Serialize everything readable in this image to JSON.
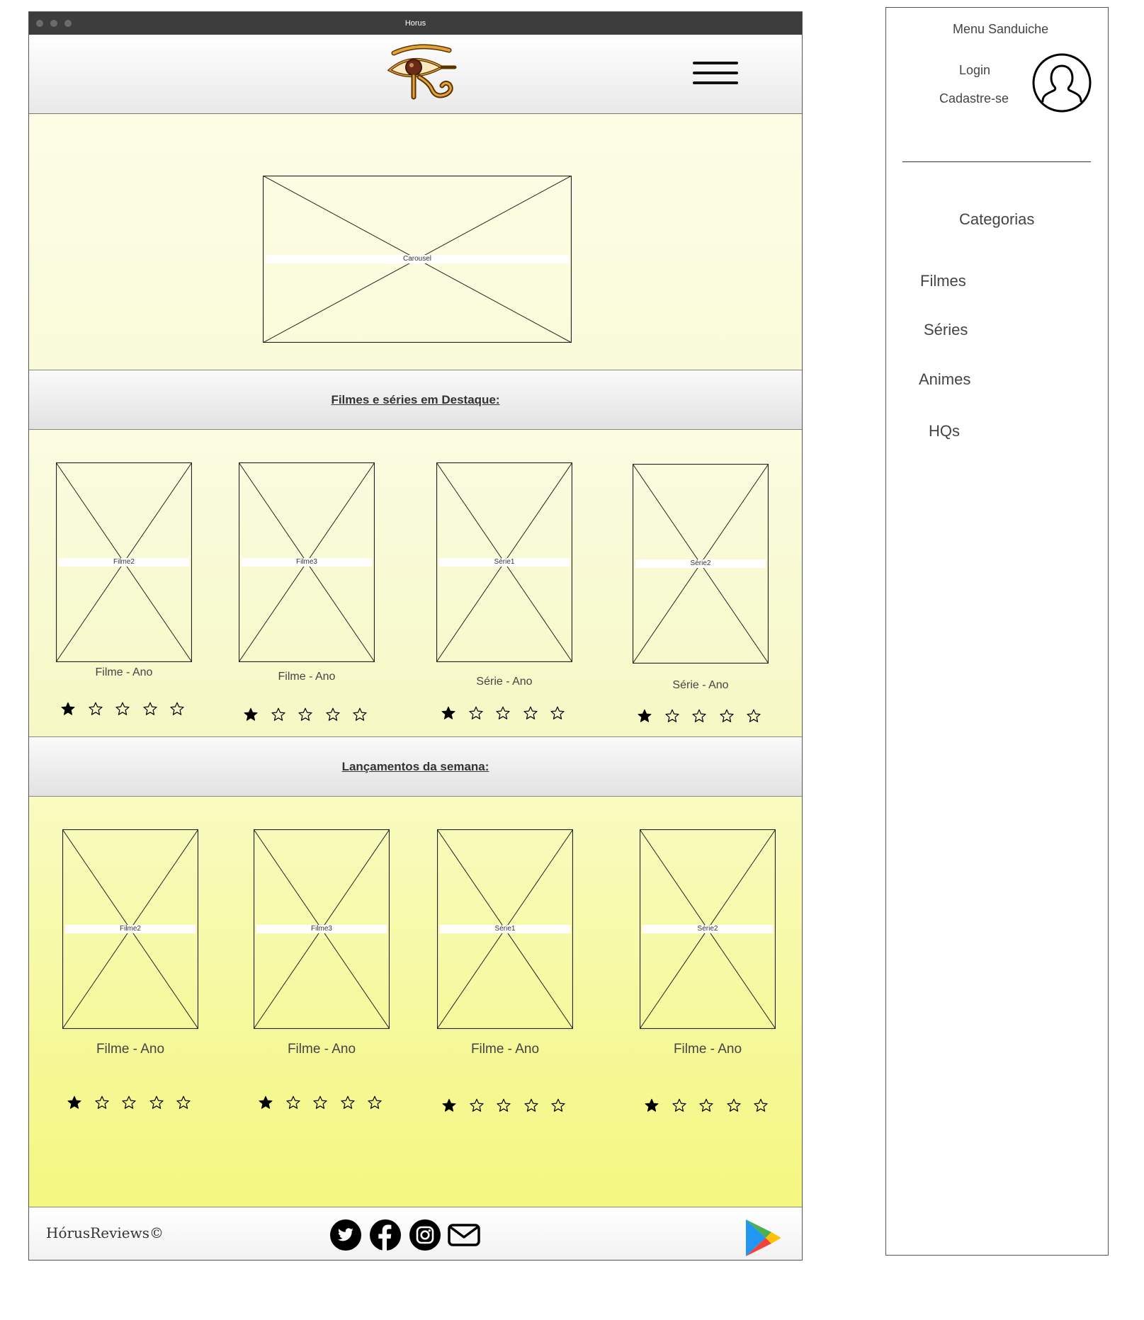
{
  "window": {
    "title": "Horus"
  },
  "header": {
    "logo_icon": "eye-of-horus-logo",
    "menu_icon": "hamburger-icon"
  },
  "hero": {
    "carousel_label": "Carousel"
  },
  "featured": {
    "heading": "Filmes e séries em Destaque:",
    "items": [
      {
        "image_label": "Filme2",
        "caption": "Filme - Ano",
        "rating": 1
      },
      {
        "image_label": "Filme3",
        "caption": "Filme - Ano",
        "rating": 1
      },
      {
        "image_label": "Série1",
        "caption": "Série - Ano",
        "rating": 1
      },
      {
        "image_label": "Série2",
        "caption": "Série - Ano",
        "rating": 1
      }
    ]
  },
  "releases": {
    "heading": "Lançamentos da semana:",
    "items": [
      {
        "image_label": "Filme2",
        "caption": "Filme - Ano",
        "rating": 1
      },
      {
        "image_label": "Filme3",
        "caption": "Filme - Ano",
        "rating": 1
      },
      {
        "image_label": "Série1",
        "caption": "Filme - Ano",
        "rating": 1
      },
      {
        "image_label": "Série2",
        "caption": "Filme - Ano",
        "rating": 1
      }
    ]
  },
  "footer": {
    "copyright": "HórusReviews©",
    "social_icons": [
      "twitter-icon",
      "facebook-icon",
      "instagram-icon",
      "mail-icon"
    ],
    "store_icon": "google-play-icon"
  },
  "side_menu": {
    "title": "Menu Sanduiche",
    "login": "Login",
    "signup": "Cadastre-se",
    "avatar_icon": "user-avatar-icon",
    "categories_heading": "Categorias",
    "categories": [
      "Filmes",
      "Séries",
      "Animes",
      "HQs"
    ]
  }
}
